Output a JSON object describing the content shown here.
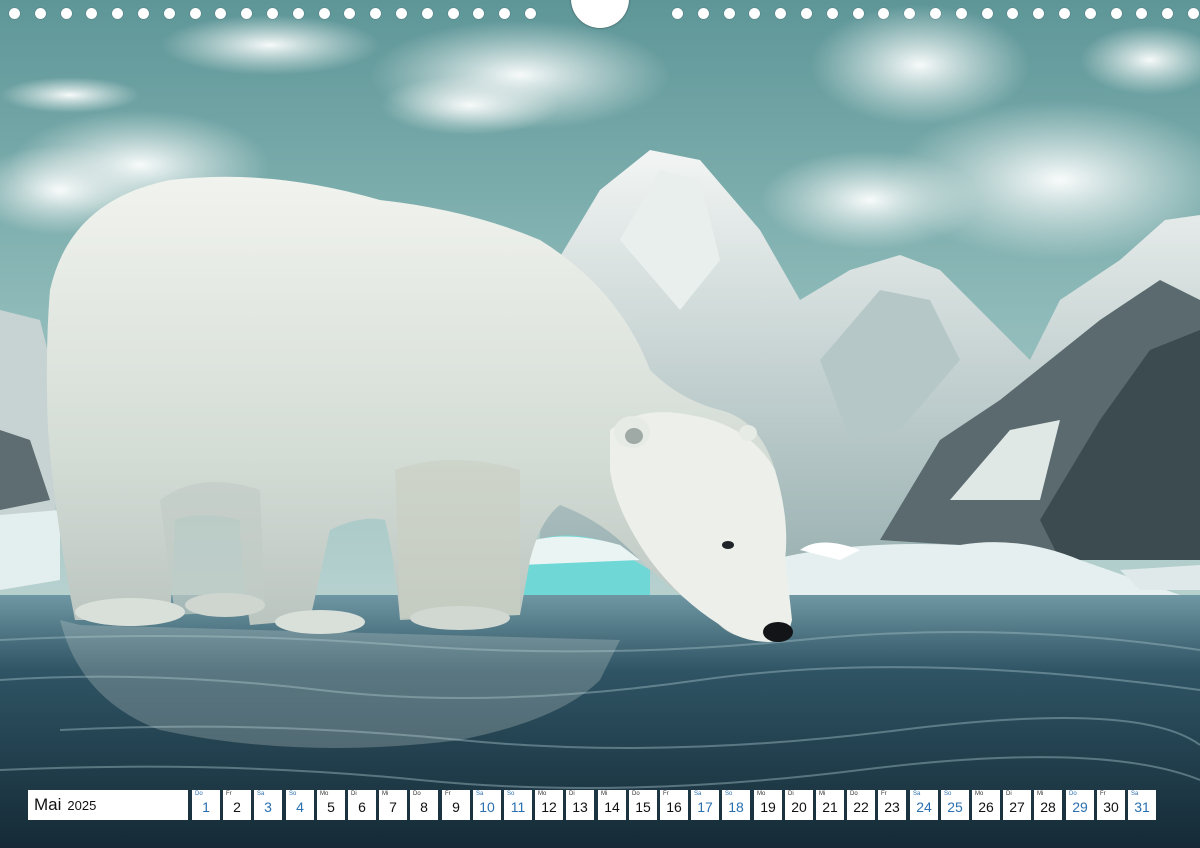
{
  "calendar": {
    "month": "Mai",
    "year": "2025",
    "days": [
      {
        "dow": "Do",
        "num": "1",
        "type": "hol"
      },
      {
        "dow": "Fr",
        "num": "2",
        "type": ""
      },
      {
        "dow": "Sa",
        "num": "3",
        "type": "we"
      },
      {
        "dow": "So",
        "num": "4",
        "type": "we"
      },
      {
        "dow": "Mo",
        "num": "5",
        "type": ""
      },
      {
        "dow": "Di",
        "num": "6",
        "type": ""
      },
      {
        "dow": "Mi",
        "num": "7",
        "type": ""
      },
      {
        "dow": "Do",
        "num": "8",
        "type": ""
      },
      {
        "dow": "Fr",
        "num": "9",
        "type": ""
      },
      {
        "dow": "Sa",
        "num": "10",
        "type": "we"
      },
      {
        "dow": "So",
        "num": "11",
        "type": "we"
      },
      {
        "dow": "Mo",
        "num": "12",
        "type": ""
      },
      {
        "dow": "Di",
        "num": "13",
        "type": ""
      },
      {
        "dow": "Mi",
        "num": "14",
        "type": ""
      },
      {
        "dow": "Do",
        "num": "15",
        "type": ""
      },
      {
        "dow": "Fr",
        "num": "16",
        "type": ""
      },
      {
        "dow": "Sa",
        "num": "17",
        "type": "we"
      },
      {
        "dow": "So",
        "num": "18",
        "type": "we"
      },
      {
        "dow": "Mo",
        "num": "19",
        "type": ""
      },
      {
        "dow": "Di",
        "num": "20",
        "type": ""
      },
      {
        "dow": "Mi",
        "num": "21",
        "type": ""
      },
      {
        "dow": "Do",
        "num": "22",
        "type": ""
      },
      {
        "dow": "Fr",
        "num": "23",
        "type": ""
      },
      {
        "dow": "Sa",
        "num": "24",
        "type": "we"
      },
      {
        "dow": "So",
        "num": "25",
        "type": "we"
      },
      {
        "dow": "Mo",
        "num": "26",
        "type": ""
      },
      {
        "dow": "Di",
        "num": "27",
        "type": ""
      },
      {
        "dow": "Mi",
        "num": "28",
        "type": ""
      },
      {
        "dow": "Do",
        "num": "29",
        "type": "hol"
      },
      {
        "dow": "Fr",
        "num": "30",
        "type": ""
      },
      {
        "dow": "Sa",
        "num": "31",
        "type": "we"
      }
    ]
  },
  "photo": {
    "subject": "polar-bear-drinking",
    "colors": {
      "sky": "#7fb0b0",
      "cloud": "#f1f4ef",
      "mountain": "#c9d6d4",
      "mountain_dark": "#3c4b50",
      "bear": "#e8ece6",
      "water": "#1f3a48",
      "ice": "#6fd8d6"
    }
  },
  "accent_color": "#2a6fb0"
}
